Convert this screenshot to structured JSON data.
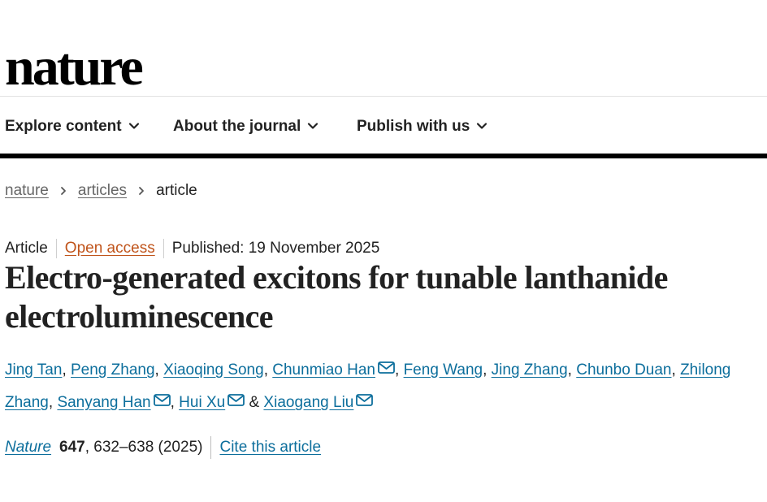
{
  "header": {
    "logo": "nature"
  },
  "nav": {
    "items": [
      {
        "label": "Explore content"
      },
      {
        "label": "About the journal"
      },
      {
        "label": "Publish with us"
      }
    ]
  },
  "breadcrumb": {
    "items": [
      {
        "label": "nature"
      },
      {
        "label": "articles"
      }
    ],
    "current": "article"
  },
  "article": {
    "type": "Article",
    "access": "Open access",
    "published": "Published: 19 November 2025",
    "title": "Electro-generated excitons for tunable lanthanide electroluminescence",
    "authors": [
      {
        "name": "Jing Tan",
        "suffix": ", "
      },
      {
        "name": "Peng Zhang",
        "suffix": ", "
      },
      {
        "name": "Xiaoqing Song",
        "suffix": ", "
      },
      {
        "name": "Chunmiao Han",
        "suffix": ", "
      },
      {
        "name": "Feng Wang",
        "suffix": ", "
      },
      {
        "name": "Jing Zhang",
        "suffix": ", "
      },
      {
        "name": "Chunbo Duan",
        "suffix": ", "
      },
      {
        "name": "Zhilong Zhang",
        "suffix": ", "
      },
      {
        "name": "Sanyang Han",
        "suffix": ", "
      },
      {
        "name": "Hui Xu",
        "suffix": " & "
      },
      {
        "name": "Xiaogang Liu",
        "suffix": ""
      }
    ],
    "citation": {
      "journal": "Nature",
      "volume": "647",
      "pages_year": ", 632–638 (2025)",
      "cite_label": "Cite this article"
    }
  },
  "icons": {
    "chevron": "chevron-down-icon",
    "crumb_separator": "chevron-right-icon",
    "corresponding": "mail-icon"
  },
  "colors": {
    "link": "#0c6e9c",
    "open_access": "#c0541b",
    "text": "#222222"
  }
}
